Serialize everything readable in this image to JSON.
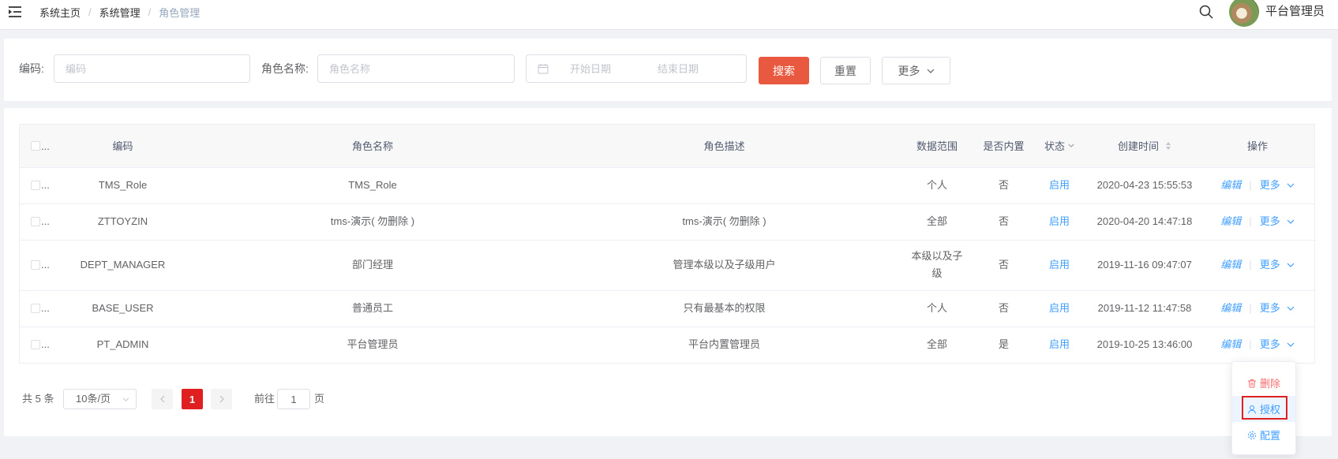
{
  "header": {
    "menu_icon": "menu-fold-icon",
    "breadcrumb": [
      "系统主页",
      "系统管理",
      "角色管理"
    ],
    "separator": "/",
    "search_icon": "search-icon",
    "user_name": "平台管理员"
  },
  "search": {
    "code_label": "编码:",
    "code_placeholder": "编码",
    "name_label": "角色名称:",
    "name_placeholder": "角色名称",
    "calendar_icon": "calendar-icon",
    "date_start_placeholder": "开始日期",
    "date_end_placeholder": "结束日期",
    "search_button": "搜索",
    "reset_button": "重置",
    "more_button": "更多"
  },
  "table": {
    "cell_ellipsis": "...",
    "columns": [
      "编码",
      "角色名称",
      "角色描述",
      "数据范围",
      "是否内置",
      "状态",
      "创建时间",
      "操作"
    ],
    "rows": [
      {
        "code": "TMS_Role",
        "name": "TMS_Role",
        "description": "",
        "data_range": "个人",
        "builtin": "否",
        "status": "启用",
        "created_at": "2020-04-23 15:55:53"
      },
      {
        "code": "ZTTOYZIN",
        "name": "tms-演示( 勿删除 )",
        "description": "tms-演示( 勿删除 )",
        "data_range": "全部",
        "builtin": "否",
        "status": "启用",
        "created_at": "2020-04-20 14:47:18"
      },
      {
        "code": "DEPT_MANAGER",
        "name": "部门经理",
        "description": "管理本级以及子级用户",
        "data_range": "本级以及子级",
        "builtin": "否",
        "status": "启用",
        "created_at": "2019-11-16 09:47:07"
      },
      {
        "code": "BASE_USER",
        "name": "普通员工",
        "description": "只有最基本的权限",
        "data_range": "个人",
        "builtin": "否",
        "status": "启用",
        "created_at": "2019-11-12 11:47:58"
      },
      {
        "code": "PT_ADMIN",
        "name": "平台管理员",
        "description": "平台内置管理员",
        "data_range": "全部",
        "builtin": "是",
        "status": "启用",
        "created_at": "2019-10-25 13:46:00"
      }
    ],
    "action_edit": "编辑",
    "action_separator": "|",
    "action_more": "更多"
  },
  "pagination": {
    "total": "共 5 条",
    "page_size": "10条/页",
    "current_page": "1",
    "goto_label": "前往",
    "goto_value": "1",
    "page_suffix": "页"
  },
  "dropdown": {
    "items": [
      {
        "label": "删除",
        "icon": "trash-icon"
      },
      {
        "label": "授权",
        "icon": "user-icon",
        "highlighted": true
      },
      {
        "label": "配置",
        "icon": "gear-icon"
      }
    ]
  },
  "colors": {
    "accent": "#409eff",
    "search_button": "#e8593f",
    "current_page": "#e02020",
    "danger": "#f56c6c",
    "highlight_border": "#e02020",
    "breadcrumb_current": "#97a8be"
  }
}
